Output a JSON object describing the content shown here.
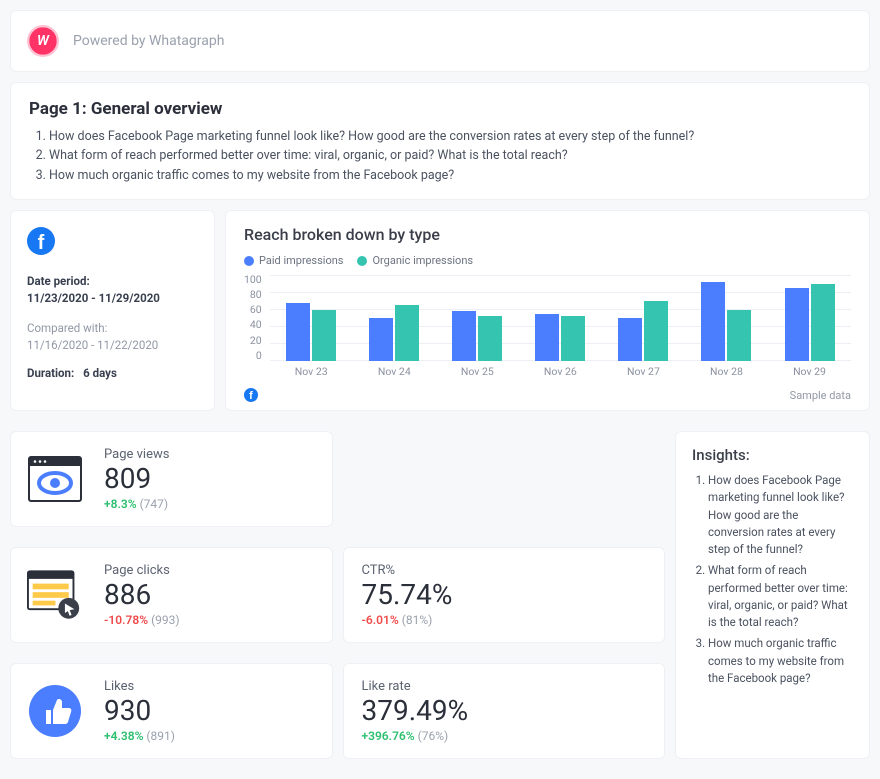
{
  "header": {
    "powered_by": "Powered by Whatagraph",
    "logo_letter": "W"
  },
  "overview": {
    "title": "Page 1: General overview",
    "questions": [
      "How does Facebook Page marketing funnel look like? How good are the conversion rates at every step of the funnel?",
      "What form of reach performed better over time: viral, organic, or paid? What is the total reach?",
      "How much organic traffic comes to my website from the Facebook page?"
    ]
  },
  "date_panel": {
    "period_label": "Date period:",
    "period_value": "11/23/2020 - 11/29/2020",
    "compared_label": "Compared with:",
    "compared_value": "11/16/2020 - 11/22/2020",
    "duration_label": "Duration:",
    "duration_value": "6 days"
  },
  "chart": {
    "title": "Reach broken down by type",
    "legend": [
      "Paid impressions",
      "Organic impressions"
    ],
    "sample_label": "Sample data"
  },
  "chart_data": {
    "type": "bar",
    "title": "Reach broken down by type",
    "xlabel": "",
    "ylabel": "",
    "ylim": [
      0,
      100
    ],
    "y_ticks": [
      100,
      80,
      60,
      40,
      20,
      0
    ],
    "categories": [
      "Nov 23",
      "Nov 24",
      "Nov 25",
      "Nov 26",
      "Nov 27",
      "Nov 28",
      "Nov 29"
    ],
    "series": [
      {
        "name": "Paid impressions",
        "color": "#4a7eff",
        "values": [
          68,
          50,
          58,
          55,
          50,
          92,
          85
        ]
      },
      {
        "name": "Organic impressions",
        "color": "#35c4b0",
        "values": [
          60,
          65,
          52,
          52,
          70,
          60,
          90
        ]
      }
    ]
  },
  "metrics": {
    "page_views": {
      "label": "Page views",
      "value": "809",
      "delta": "+8.3%",
      "delta_sign": "pos",
      "prev": "(747)"
    },
    "page_clicks": {
      "label": "Page clicks",
      "value": "886",
      "delta": "-10.78%",
      "delta_sign": "neg",
      "prev": "(993)"
    },
    "likes": {
      "label": "Likes",
      "value": "930",
      "delta": "+4.38%",
      "delta_sign": "pos",
      "prev": "(891)"
    },
    "ctr": {
      "label": "CTR%",
      "value": "75.74%",
      "delta": "-6.01%",
      "delta_sign": "neg",
      "prev": "(81%)"
    },
    "like_rate": {
      "label": "Like rate",
      "value": "379.49%",
      "delta": "+396.76%",
      "delta_sign": "pos",
      "prev": "(76%)"
    }
  },
  "insights": {
    "title": "Insights:",
    "items": [
      "How does Facebook Page marketing funnel look like? How good are the conversion rates at every step of the funnel?",
      "What form of reach performed better over time: viral, organic, or paid? What is the total reach?",
      "How much organic traffic comes to my website from the Facebook page?"
    ]
  }
}
